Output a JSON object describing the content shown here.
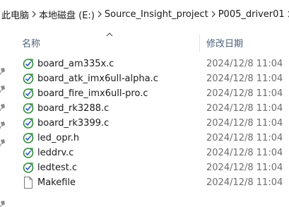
{
  "breadcrumb": {
    "items": [
      "此电脑",
      "本地磁盘 (E:)",
      "Source_Insight_project",
      "P005_driver01"
    ],
    "separator_icon": "chevron-right-icon"
  },
  "columns": {
    "name": "名称",
    "date_modified": "修改日期",
    "sort_icon": "sort-ascending-icon"
  },
  "files": [
    {
      "name": "board_am335x.c",
      "date": "2024/12/8 11:04",
      "icon": "c-source-file-icon"
    },
    {
      "name": "board_atk_imx6ull-alpha.c",
      "date": "2024/12/8 11:04",
      "icon": "c-source-file-icon"
    },
    {
      "name": "board_fire_imx6ull-pro.c",
      "date": "2024/12/8 11:04",
      "icon": "c-source-file-icon"
    },
    {
      "name": "board_rk3288.c",
      "date": "2024/12/8 11:04",
      "icon": "c-source-file-icon"
    },
    {
      "name": "board_rk3399.c",
      "date": "2024/12/8 11:04",
      "icon": "c-source-file-icon"
    },
    {
      "name": "led_opr.h",
      "date": "2024/12/8 11:04",
      "icon": "c-header-file-icon"
    },
    {
      "name": "leddrv.c",
      "date": "2024/12/8 11:04",
      "icon": "c-source-file-icon"
    },
    {
      "name": "ledtest.c",
      "date": "2024/12/8 11:04",
      "icon": "c-source-file-icon"
    },
    {
      "name": "Makefile",
      "date": "2024/12/8 11:04",
      "icon": "generic-file-icon"
    }
  ],
  "colors": {
    "header_text": "#4c607a",
    "date_text": "#6d6d6d",
    "icon_green": "#2f8a3a",
    "icon_blue": "#2a5fbf"
  }
}
